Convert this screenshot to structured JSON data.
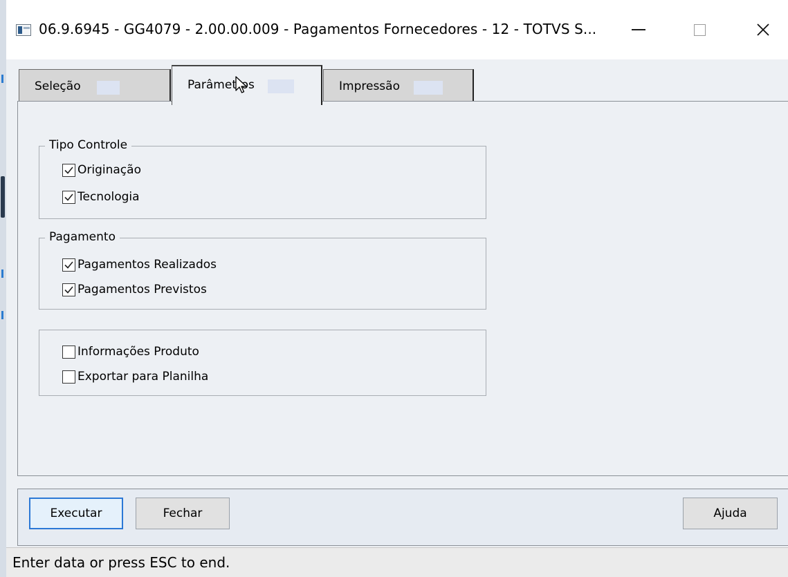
{
  "window": {
    "title": "06.9.6945 - GG4079 - 2.00.00.009 - Pagamentos Fornecedores - 12 - TOTVS S...",
    "icon": "app-window-icon",
    "controls": {
      "minimize": "minimize-icon",
      "maximize": "maximize-icon",
      "close": "✕"
    }
  },
  "tabs": [
    {
      "label": "Seleção",
      "selected": false
    },
    {
      "label": "Parâmetros",
      "selected": true
    },
    {
      "label": "Impressão",
      "selected": false
    }
  ],
  "groups": {
    "tipo_controle": {
      "title": "Tipo Controle",
      "items": [
        {
          "label": "Originação",
          "checked": true
        },
        {
          "label": "Tecnologia",
          "checked": true
        }
      ]
    },
    "pagamento": {
      "title": "Pagamento",
      "items": [
        {
          "label": "Pagamentos Realizados",
          "checked": true
        },
        {
          "label": "Pagamentos Previstos",
          "checked": true
        }
      ]
    },
    "outros": {
      "title": "",
      "items": [
        {
          "label": "Informações Produto",
          "checked": false
        },
        {
          "label": "Exportar para Planilha",
          "checked": false
        }
      ]
    }
  },
  "buttons": {
    "executar": "Executar",
    "fechar": "Fechar",
    "ajuda": "Ajuda"
  },
  "status": "Enter data or press ESC to end.",
  "colors": {
    "client_bg": "#edf0f4",
    "focus_border": "#2b78d6",
    "tab_bg": "#d6d6d6"
  }
}
